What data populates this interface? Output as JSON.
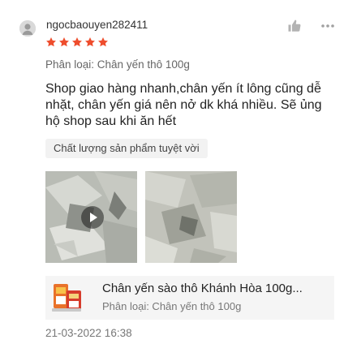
{
  "review": {
    "username": "ngocbaouyen282411",
    "rating": 5,
    "variation": "Phân loại: Chân yến thô 100g",
    "text": "Shop giao hàng nhanh,chân yến ít lông cũng dễ nhặt, chân yến giá nên nở dk khá nhiều. Sẽ ủng hộ shop sau khi ăn hết",
    "tag": "Chất lượng sản phẩm tuyệt vời",
    "date": "21-03-2022 16:38"
  },
  "product": {
    "name": "Chân yến sào thô Khánh Hòa 100g...",
    "variation": "Phân loại: Chân yến thô 100g"
  },
  "icons": {
    "avatar": "user-avatar-icon",
    "like": "thumbs-up-icon",
    "more": "more-dots-icon",
    "star": "star-icon",
    "play": "play-icon"
  },
  "colors": {
    "star": "#ee4d2d",
    "muted_text": "#777777",
    "tag_bg": "#f2f2f2",
    "product_bg": "#f5f5f5"
  }
}
